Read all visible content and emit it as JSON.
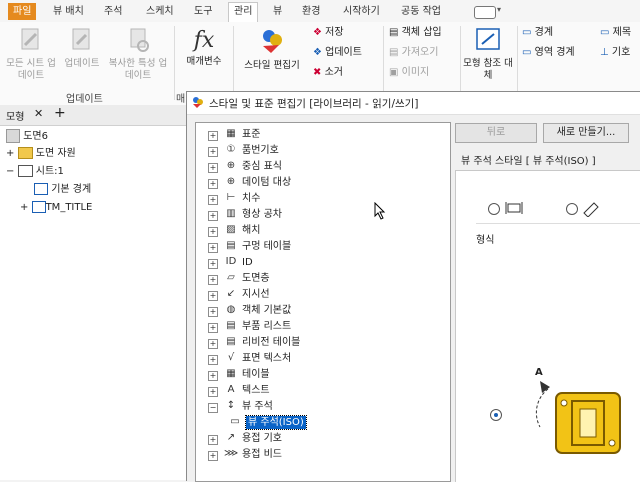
{
  "menu": {
    "tabs": [
      "파일",
      "뷰 배치",
      "주석",
      "스케치",
      "도구",
      "관리",
      "뷰",
      "환경",
      "시작하기",
      "공동 작업"
    ],
    "active": "관리"
  },
  "ribbon": {
    "update_group": {
      "buttons": [
        "모든 시트 업데이트",
        "업데이트",
        "복사한 특성 업데이트"
      ],
      "label": "업데이트"
    },
    "params_label": "매개변수",
    "style_editor_label": "스타일 편집기",
    "style_small": [
      "저장",
      "업데이트",
      "소거"
    ],
    "insert_small": [
      "객체 삽입",
      "가져오기",
      "이미지"
    ],
    "model_ref_label": "모형 참조 대체",
    "right_small": [
      "경계",
      "영역 경계"
    ],
    "far_right_small": [
      "제목",
      "기호"
    ]
  },
  "browser": {
    "tab_label": "모형",
    "tree": [
      "도면6",
      "도면 자원",
      "시트:1",
      "기본 경계",
      "TM_TITLE"
    ]
  },
  "dialog": {
    "title": "스타일 및 표준 편집기 [라이브러리 - 읽기/쓰기]",
    "back_label": "뒤로",
    "new_label": "새로 만들기...",
    "view_style_heading": "뷰 주석 스타일 [ 뷰 주석(ISO) ]",
    "format_label": "형식",
    "arrow_label": "A",
    "style_items": [
      "표준",
      "품번기호",
      "중심 표식",
      "데이텀 대상",
      "치수",
      "형상 공차",
      "해치",
      "구멍 테이블",
      "ID",
      "도면층",
      "지시선",
      "객체 기본값",
      "부품 리스트",
      "리비전 테이블",
      "표면 텍스처",
      "테이블",
      "텍스트",
      "뷰 주석",
      "뷰 주석(ISO)",
      "용접 기호",
      "용접 비드"
    ],
    "selected_item": "뷰 주석(ISO)"
  },
  "colors": {
    "file_tab": "#e58a1f",
    "accent": "#1a5fb4",
    "selection": "#0a64c8",
    "gold": "#f2c316"
  }
}
